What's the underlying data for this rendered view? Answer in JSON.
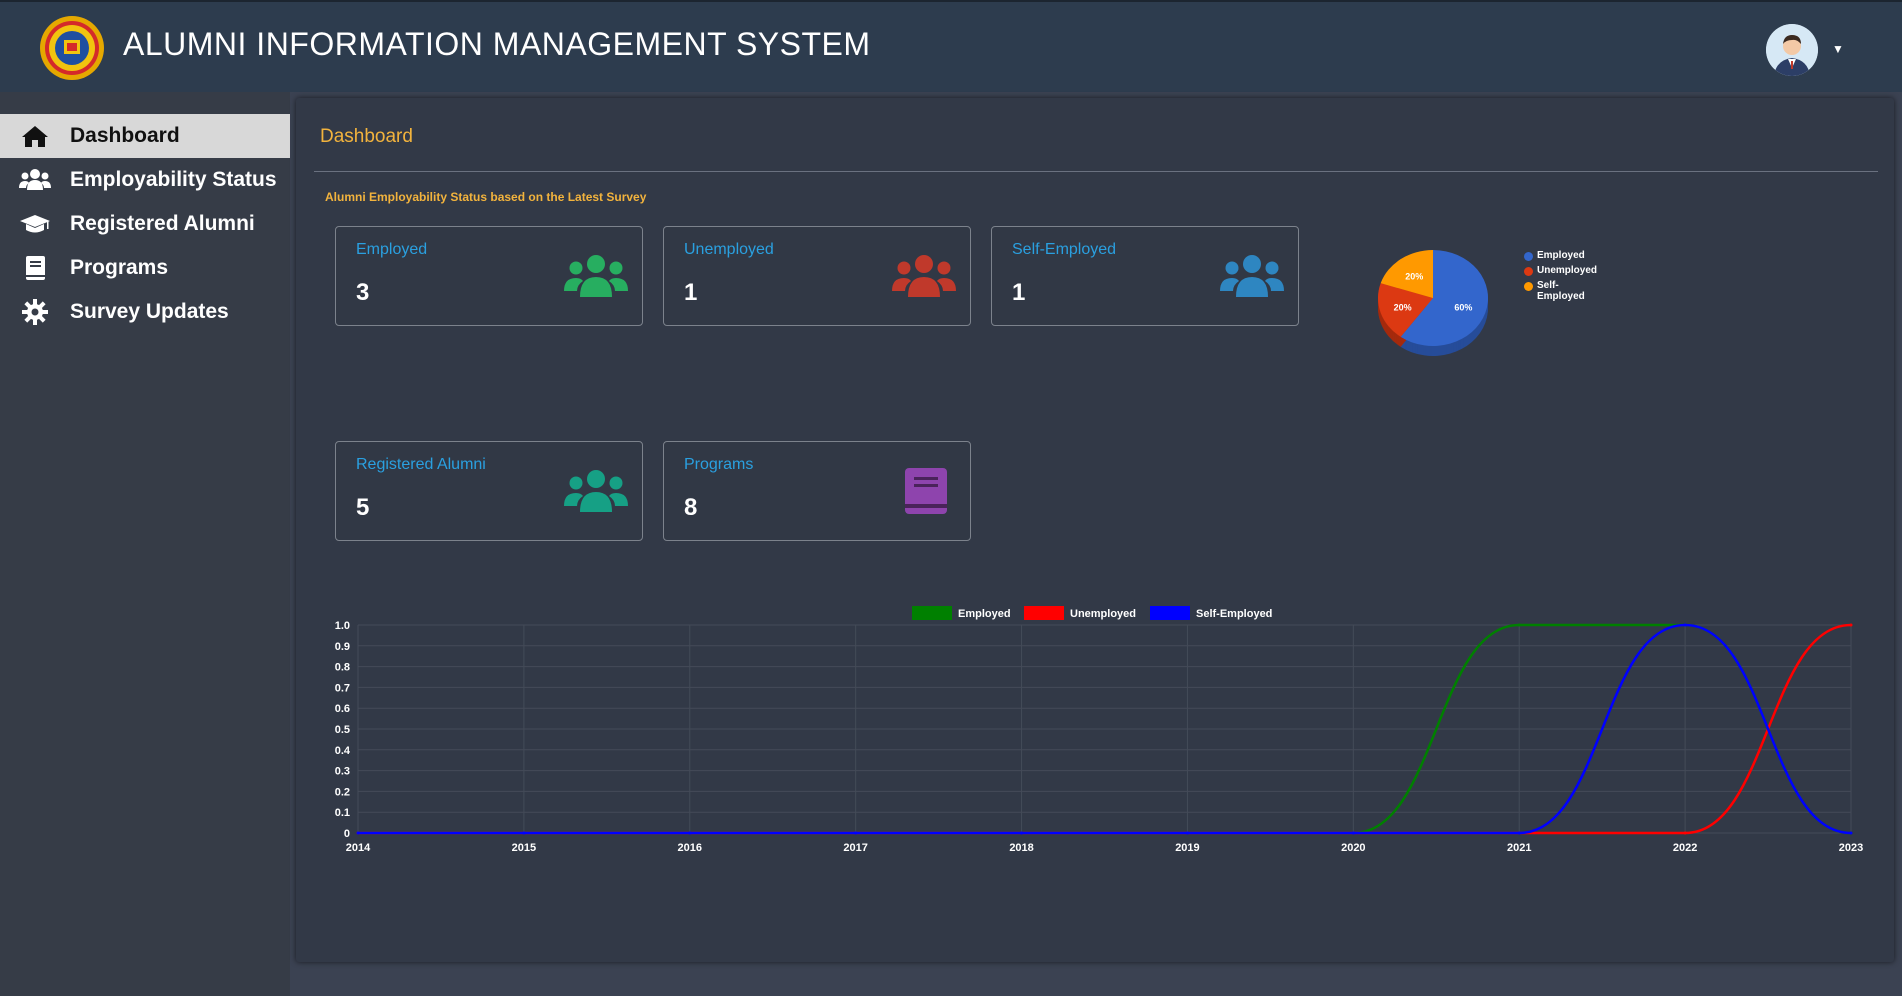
{
  "header": {
    "title": "ALUMNI INFORMATION MANAGEMENT SYSTEM",
    "logo_icon": "university-seal-icon",
    "avatar_icon": "user-avatar-icon"
  },
  "sidebar": {
    "items": [
      {
        "label": "Dashboard",
        "icon": "home-icon",
        "active": true
      },
      {
        "label": "Employability Status",
        "icon": "users-icon",
        "active": false
      },
      {
        "label": "Registered Alumni",
        "icon": "graduation-cap-icon",
        "active": false
      },
      {
        "label": "Programs",
        "icon": "book-icon",
        "active": false
      },
      {
        "label": "Survey Updates",
        "icon": "gear-icon",
        "active": false
      }
    ]
  },
  "main": {
    "title": "Dashboard",
    "subtitle": "Alumni Employability Status based on the Latest Survey",
    "cards": [
      {
        "label": "Employed",
        "value": "3",
        "icon": "users-icon",
        "color": "#27ae60"
      },
      {
        "label": "Unemployed",
        "value": "1",
        "icon": "users-icon",
        "color": "#c0392b"
      },
      {
        "label": "Self-Employed",
        "value": "1",
        "icon": "users-icon",
        "color": "#2e86c1"
      },
      {
        "label": "Registered Alumni",
        "value": "5",
        "icon": "users-icon",
        "color": "#16a085"
      },
      {
        "label": "Programs",
        "value": "8",
        "icon": "book-icon",
        "color": "#8e44ad"
      }
    ]
  },
  "chart_data": [
    {
      "type": "pie",
      "labels": [
        "Employed",
        "Unemployed",
        "Self-Employed"
      ],
      "values": [
        60,
        20,
        20
      ],
      "value_labels": [
        "60%",
        "20%",
        "20%"
      ],
      "colors": [
        "#3366cc",
        "#dc3912",
        "#ff9900"
      ],
      "legend": "right"
    },
    {
      "type": "line",
      "x": [
        "2014",
        "2015",
        "2016",
        "2017",
        "2018",
        "2019",
        "2020",
        "2021",
        "2022",
        "2023"
      ],
      "series": [
        {
          "name": "Employed",
          "color": "#008000",
          "values": [
            0,
            0,
            0,
            0,
            0,
            0,
            0,
            1,
            1,
            0
          ]
        },
        {
          "name": "Unemployed",
          "color": "#ff0000",
          "values": [
            0,
            0,
            0,
            0,
            0,
            0,
            0,
            0,
            0,
            1
          ]
        },
        {
          "name": "Self-Employed",
          "color": "#0000ff",
          "values": [
            0,
            0,
            0,
            0,
            0,
            0,
            0,
            0,
            1,
            0
          ]
        }
      ],
      "yticks": [
        "0",
        "0.1",
        "0.2",
        "0.3",
        "0.4",
        "0.5",
        "0.6",
        "0.7",
        "0.8",
        "0.9",
        "1.0"
      ],
      "ylim": [
        0,
        1
      ],
      "legend": "top",
      "grid": true
    }
  ]
}
